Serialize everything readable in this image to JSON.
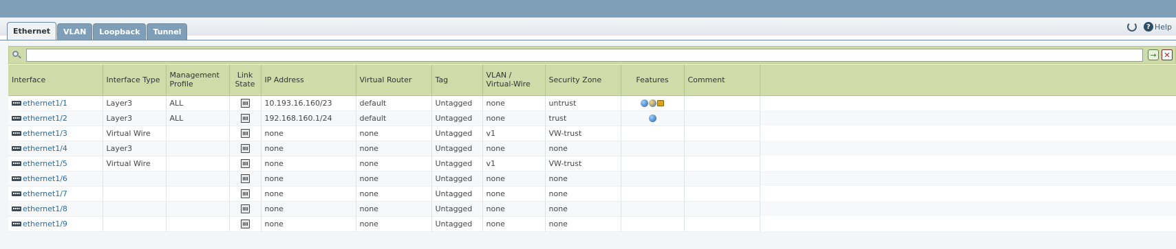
{
  "toolbar": {
    "refresh_icon": "refresh-icon",
    "help_label": "Help"
  },
  "tabs": [
    {
      "label": "Ethernet",
      "active": true
    },
    {
      "label": "VLAN",
      "active": false
    },
    {
      "label": "Loopback",
      "active": false
    },
    {
      "label": "Tunnel",
      "active": false
    }
  ],
  "filter": {
    "value": "",
    "placeholder": ""
  },
  "columns": {
    "interface": "Interface",
    "interface_type": "Interface Type",
    "management_profile": [
      "Management",
      "Profile"
    ],
    "link_state": [
      "Link",
      "State"
    ],
    "ip_address": "IP Address",
    "virtual_router": "Virtual Router",
    "tag": "Tag",
    "vlan_virtual_wire": [
      "VLAN /",
      "Virtual-Wire"
    ],
    "security_zone": "Security Zone",
    "features": "Features",
    "comment": "Comment"
  },
  "rows": [
    {
      "interface": "ethernet1/1",
      "type": "Layer3",
      "mgmt": "ALL",
      "ip": "10.193.16.160/23",
      "router": "default",
      "tag": "Untagged",
      "vlan": "none",
      "zone": "untrust",
      "features": [
        "mgmt-profile-icon",
        "dhcp-icon",
        "lldp-icon"
      ],
      "comment": ""
    },
    {
      "interface": "ethernet1/2",
      "type": "Layer3",
      "mgmt": "ALL",
      "ip": "192.168.160.1/24",
      "router": "default",
      "tag": "Untagged",
      "vlan": "none",
      "zone": "trust",
      "features": [
        "mgmt-profile-icon"
      ],
      "comment": ""
    },
    {
      "interface": "ethernet1/3",
      "type": "Virtual Wire",
      "mgmt": "",
      "ip": "none",
      "router": "none",
      "tag": "Untagged",
      "vlan": "v1",
      "zone": "VW-trust",
      "features": [],
      "comment": ""
    },
    {
      "interface": "ethernet1/4",
      "type": "Layer3",
      "mgmt": "",
      "ip": "none",
      "router": "none",
      "tag": "Untagged",
      "vlan": "none",
      "zone": "none",
      "features": [],
      "comment": ""
    },
    {
      "interface": "ethernet1/5",
      "type": "Virtual Wire",
      "mgmt": "",
      "ip": "none",
      "router": "none",
      "tag": "Untagged",
      "vlan": "v1",
      "zone": "VW-trust",
      "features": [],
      "comment": ""
    },
    {
      "interface": "ethernet1/6",
      "type": "",
      "mgmt": "",
      "ip": "none",
      "router": "none",
      "tag": "Untagged",
      "vlan": "none",
      "zone": "none",
      "features": [],
      "comment": ""
    },
    {
      "interface": "ethernet1/7",
      "type": "",
      "mgmt": "",
      "ip": "none",
      "router": "none",
      "tag": "Untagged",
      "vlan": "none",
      "zone": "none",
      "features": [],
      "comment": ""
    },
    {
      "interface": "ethernet1/8",
      "type": "",
      "mgmt": "",
      "ip": "none",
      "router": "none",
      "tag": "Untagged",
      "vlan": "none",
      "zone": "none",
      "features": [],
      "comment": ""
    },
    {
      "interface": "ethernet1/9",
      "type": "",
      "mgmt": "",
      "ip": "none",
      "router": "none",
      "tag": "Untagged",
      "vlan": "none",
      "zone": "none",
      "features": [],
      "comment": ""
    }
  ]
}
